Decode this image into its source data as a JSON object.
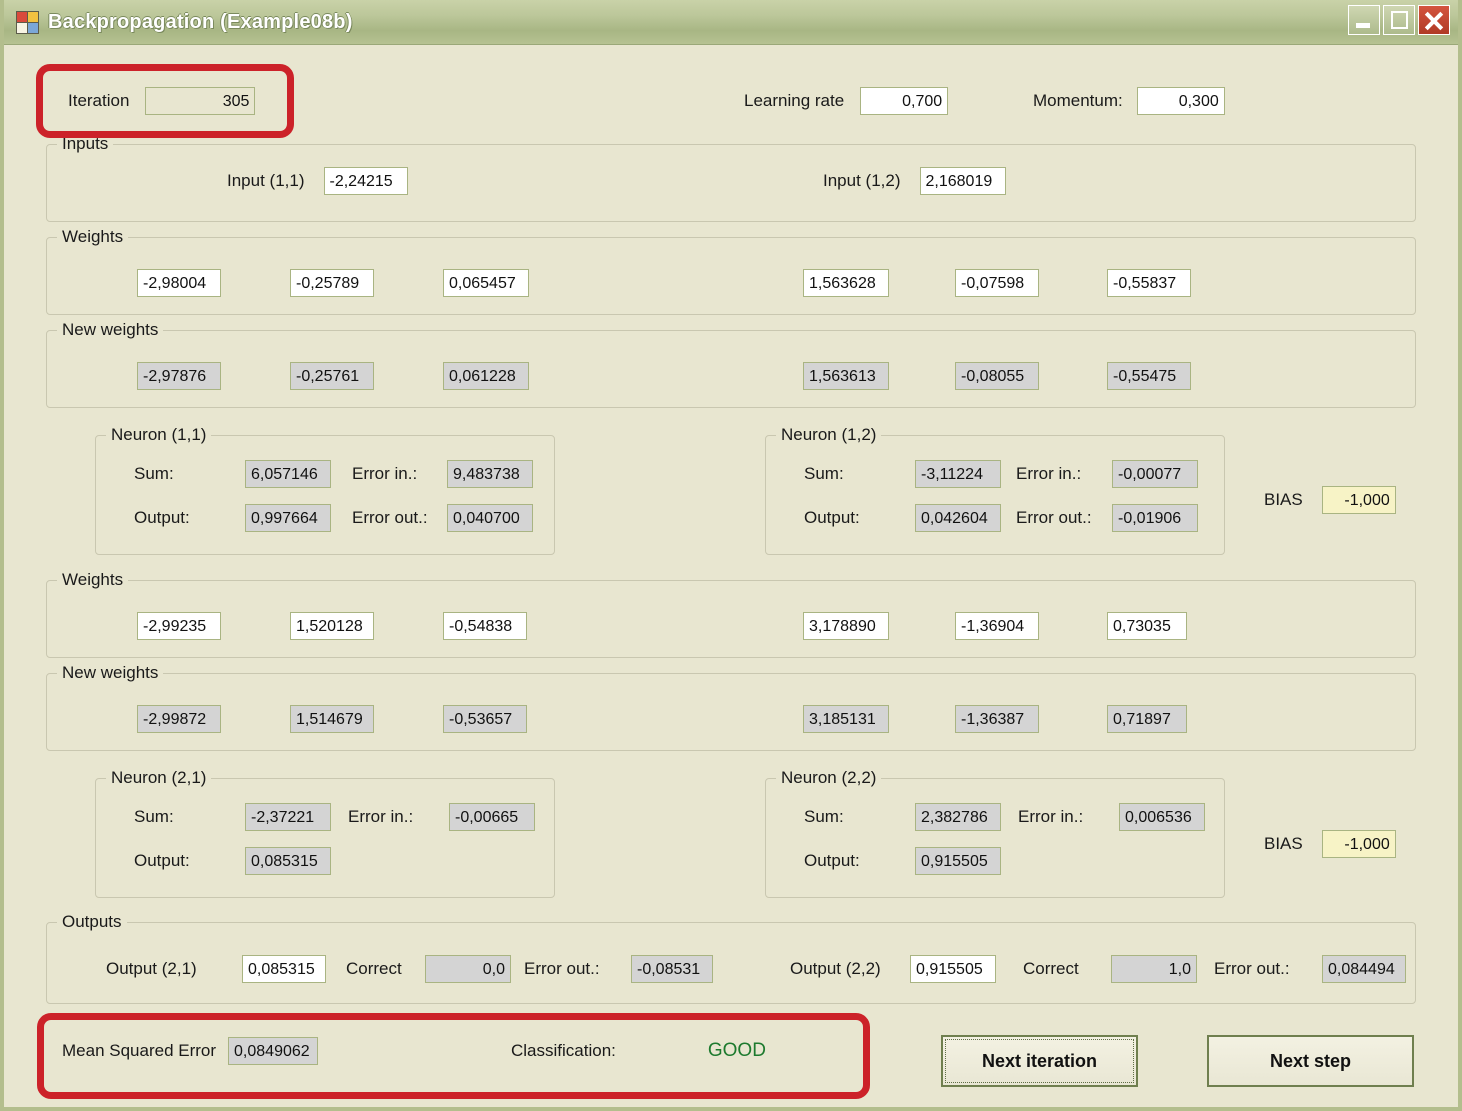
{
  "window": {
    "title": "Backpropagation (Example08b)",
    "icon": "app-squares-icon",
    "buttons": {
      "minimize": "_",
      "maximize": "□",
      "close": "✕"
    }
  },
  "header": {
    "iteration_label": "Iteration",
    "iteration_value": "305",
    "learning_rate_label": "Learning rate",
    "learning_rate_value": "0,700",
    "momentum_label": "Momentum:",
    "momentum_value": "0,300"
  },
  "inputs": {
    "group_title": "Inputs",
    "input11_label": "Input (1,1)",
    "input11_value": "-2,24215",
    "input12_label": "Input (1,2)",
    "input12_value": "2,168019"
  },
  "weights1": {
    "group_title": "Weights",
    "left": [
      "-2,98004",
      "-0,25789",
      "0,065457"
    ],
    "right": [
      "1,563628",
      "-0,07598",
      "-0,55837"
    ]
  },
  "new_weights1": {
    "group_title": "New weights",
    "left": [
      "-2,97876",
      "-0,25761",
      "0,061228"
    ],
    "right": [
      "1,563613",
      "-0,08055",
      "-0,55475"
    ]
  },
  "neuron11": {
    "group_title": "Neuron (1,1)",
    "sum_label": "Sum:",
    "sum_value": "6,057146",
    "error_in_label": "Error in.:",
    "error_in_value": "9,483738",
    "output_label": "Output:",
    "output_value": "0,997664",
    "error_out_label": "Error out.:",
    "error_out_value": "0,040700"
  },
  "neuron12": {
    "group_title": "Neuron (1,2)",
    "sum_label": "Sum:",
    "sum_value": "-3,11224",
    "error_in_label": "Error in.:",
    "error_in_value": "-0,00077",
    "output_label": "Output:",
    "output_value": "0,042604",
    "error_out_label": "Error out.:",
    "error_out_value": "-0,01906"
  },
  "bias1": {
    "label": "BIAS",
    "value": "-1,000"
  },
  "weights2": {
    "group_title": "Weights",
    "left": [
      "-2,99235",
      "1,520128",
      "-0,54838"
    ],
    "right": [
      "3,178890",
      "-1,36904",
      "0,73035"
    ]
  },
  "new_weights2": {
    "group_title": "New weights",
    "left": [
      "-2,99872",
      "1,514679",
      "-0,53657"
    ],
    "right": [
      "3,185131",
      "-1,36387",
      "0,71897"
    ]
  },
  "neuron21": {
    "group_title": "Neuron (2,1)",
    "sum_label": "Sum:",
    "sum_value": "-2,37221",
    "error_in_label": "Error in.:",
    "error_in_value": "-0,00665",
    "output_label": "Output:",
    "output_value": "0,085315"
  },
  "neuron22": {
    "group_title": "Neuron (2,2)",
    "sum_label": "Sum:",
    "sum_value": "2,382786",
    "error_in_label": "Error in.:",
    "error_in_value": "0,006536",
    "output_label": "Output:",
    "output_value": "0,915505"
  },
  "bias2": {
    "label": "BIAS",
    "value": "-1,000"
  },
  "outputs": {
    "group_title": "Outputs",
    "output21_label": "Output (2,1)",
    "output21_value": "0,085315",
    "correct1_label": "Correct",
    "correct1_value": "0,0",
    "error_out1_label": "Error out.:",
    "error_out1_value": "-0,08531",
    "output22_label": "Output (2,2)",
    "output22_value": "0,915505",
    "correct2_label": "Correct",
    "correct2_value": "1,0",
    "error_out2_label": "Error out.:",
    "error_out2_value": "0,084494"
  },
  "footer": {
    "mse_label": "Mean Squared Error",
    "mse_value": "0,0849062",
    "classification_label": "Classification:",
    "classification_value": "GOOD",
    "classification_color": "#1d7a2e",
    "next_iteration_label": "Next iteration",
    "next_step_label": "Next step"
  },
  "annotation_color": "#cc2229"
}
